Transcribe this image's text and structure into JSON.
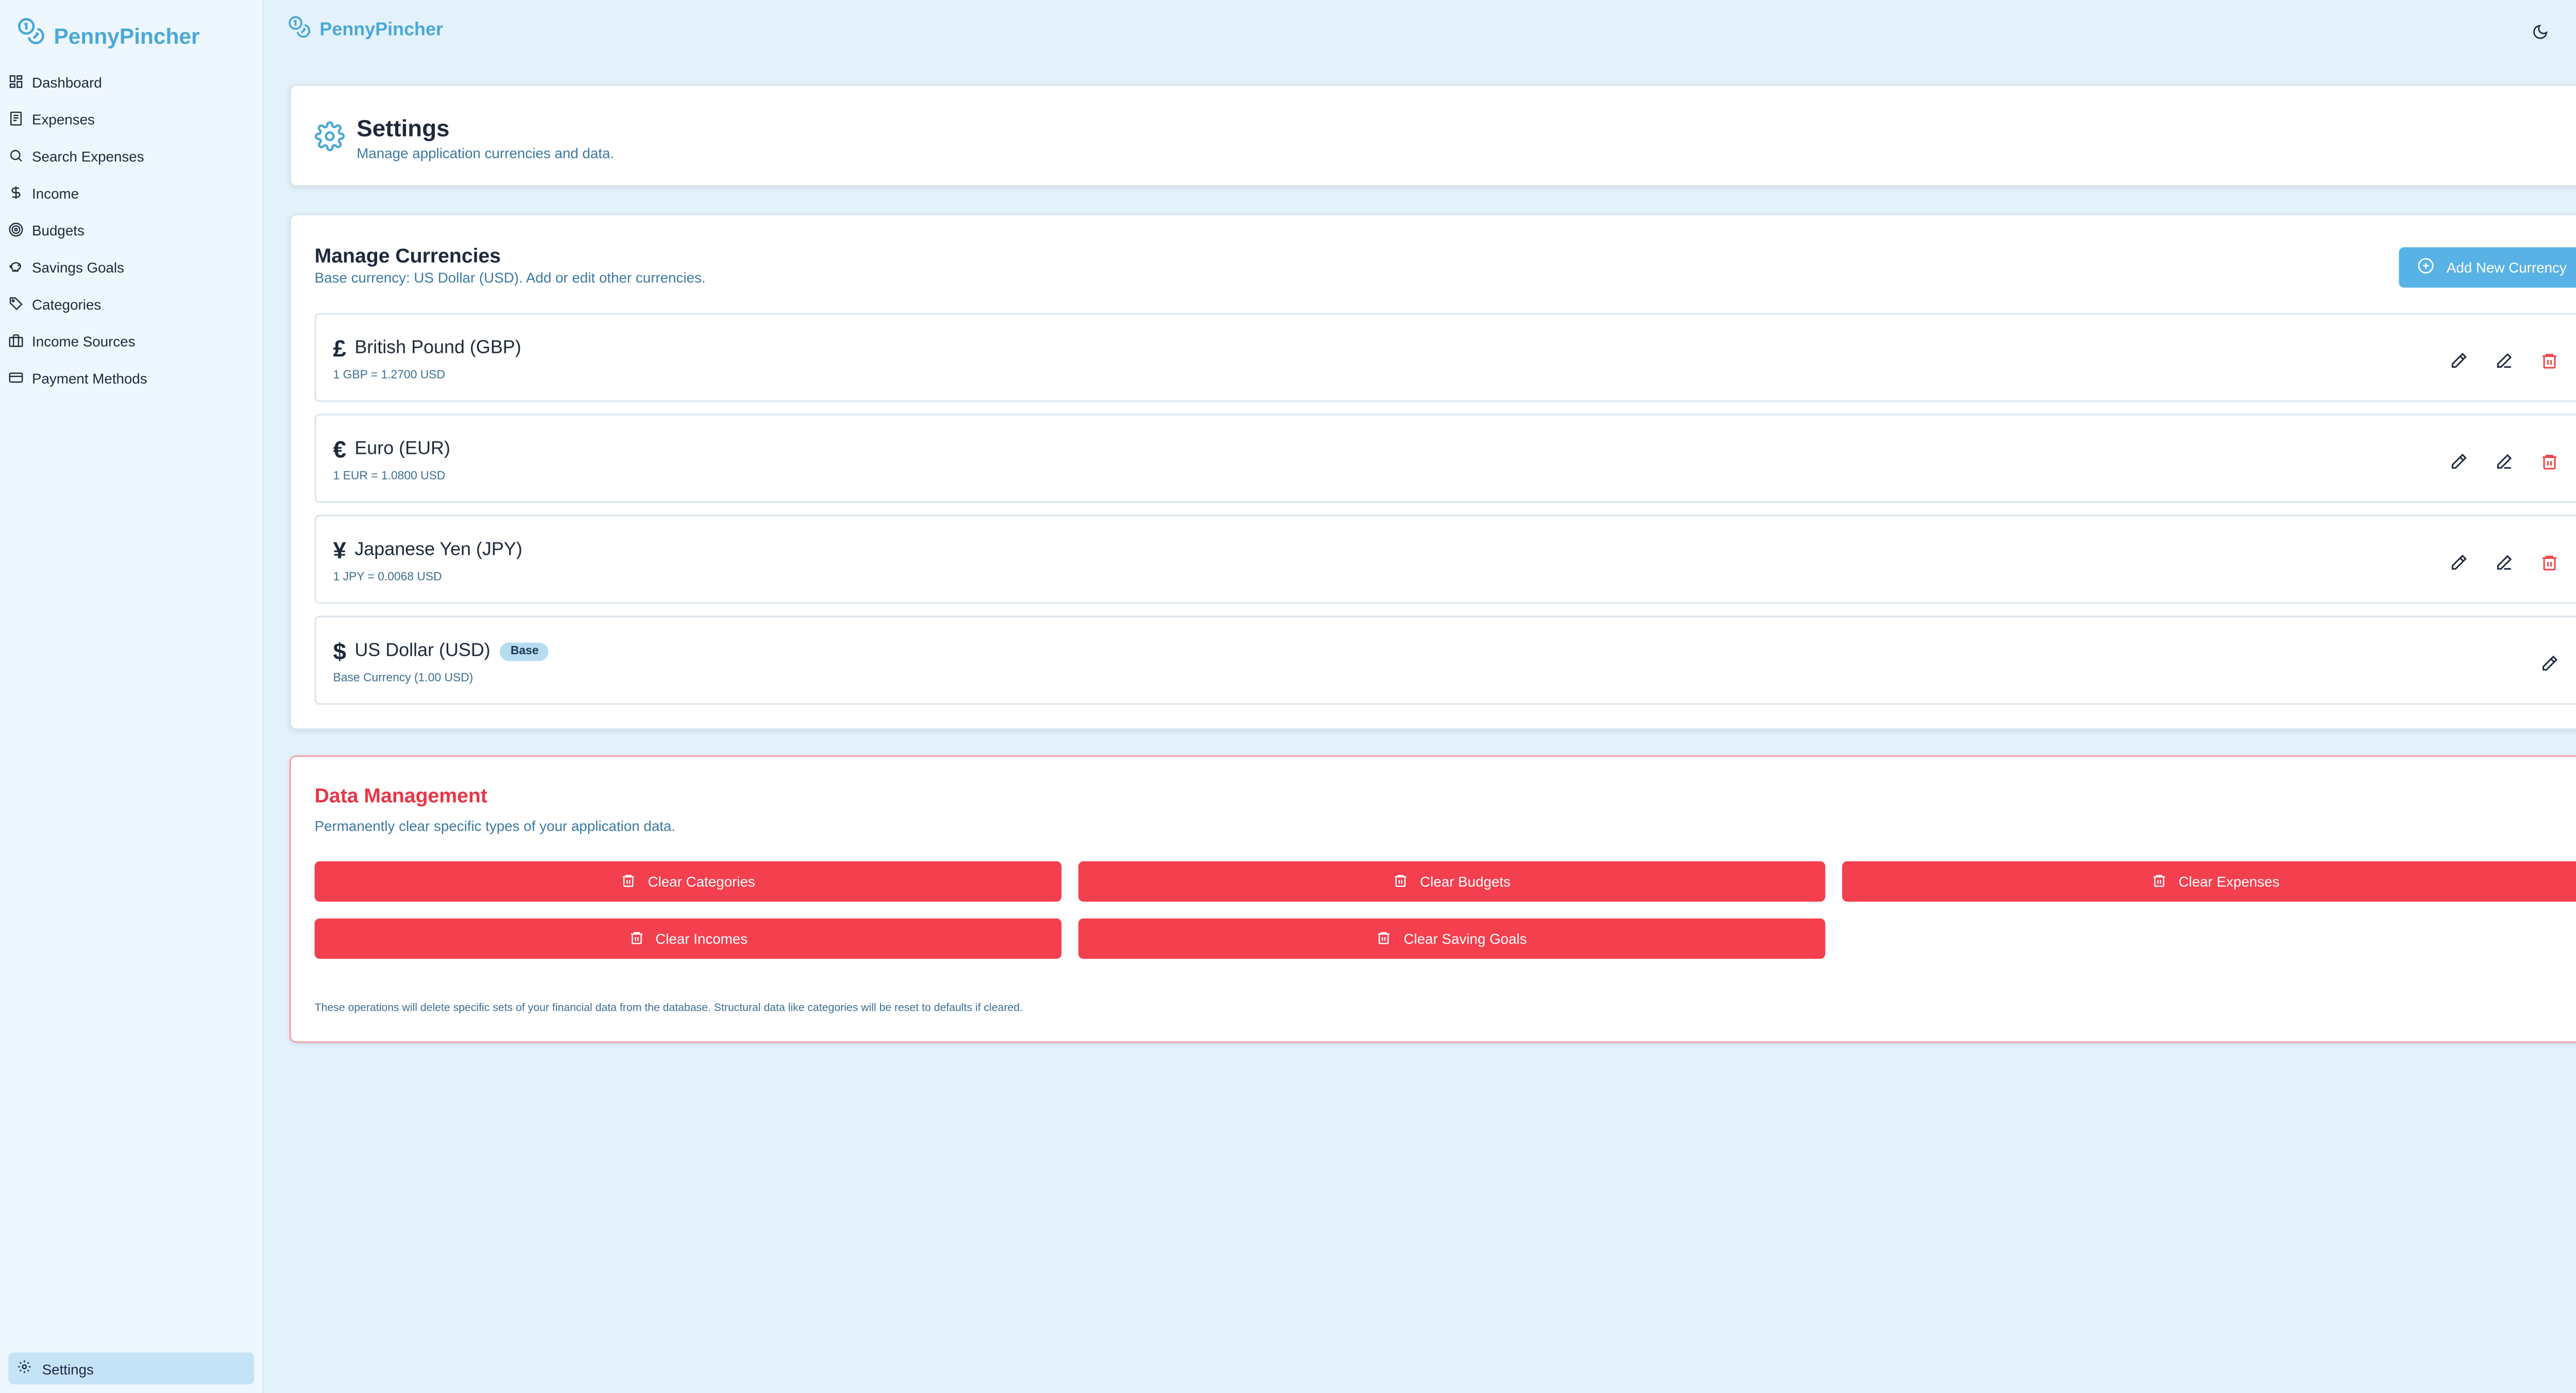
{
  "app": {
    "name": "PennyPincher"
  },
  "sidebar": {
    "items": [
      {
        "label": "Dashboard",
        "icon": "grid-icon"
      },
      {
        "label": "Expenses",
        "icon": "receipt-icon"
      },
      {
        "label": "Search Expenses",
        "icon": "search-icon"
      },
      {
        "label": "Income",
        "icon": "dollar-icon"
      },
      {
        "label": "Budgets",
        "icon": "target-icon"
      },
      {
        "label": "Savings Goals",
        "icon": "piggy-bank-icon"
      },
      {
        "label": "Categories",
        "icon": "tags-icon"
      },
      {
        "label": "Income Sources",
        "icon": "briefcase-icon"
      },
      {
        "label": "Payment Methods",
        "icon": "credit-card-icon"
      }
    ],
    "settings_label": "Settings"
  },
  "topbar": {
    "theme_icon": "moon-icon",
    "logout_icon": "logout-icon"
  },
  "settings_header": {
    "title": "Settings",
    "subtitle": "Manage application currencies and data."
  },
  "currencies": {
    "title": "Manage Currencies",
    "subtitle": "Base currency: US Dollar (USD). Add or edit other currencies.",
    "add_label": "Add New Currency",
    "items": [
      {
        "symbol": "£",
        "name": "British Pound (GBP)",
        "rate": "1 GBP = 1.2700 USD"
      },
      {
        "symbol": "€",
        "name": "Euro (EUR)",
        "rate": "1 EUR = 1.0800 USD"
      },
      {
        "symbol": "¥",
        "name": "Japanese Yen (JPY)",
        "rate": "1 JPY = 0.0068 USD"
      },
      {
        "symbol": "$",
        "name": "US Dollar (USD)",
        "rate": "Base Currency (1.00 USD)",
        "badge": "Base"
      }
    ]
  },
  "data_management": {
    "title": "Data Management",
    "subtitle": "Permanently clear specific types of your application data.",
    "buttons": [
      "Clear Categories",
      "Clear Budgets",
      "Clear Expenses",
      "Clear Incomes",
      "Clear Saving Goals"
    ],
    "note": "These operations will delete specific sets of your financial data from the database. Structural data like categories will be reset to defaults if cleared."
  },
  "colors": {
    "accent": "#4aa8d8",
    "danger": "#f43f4e",
    "background": "#e3f1fb"
  }
}
